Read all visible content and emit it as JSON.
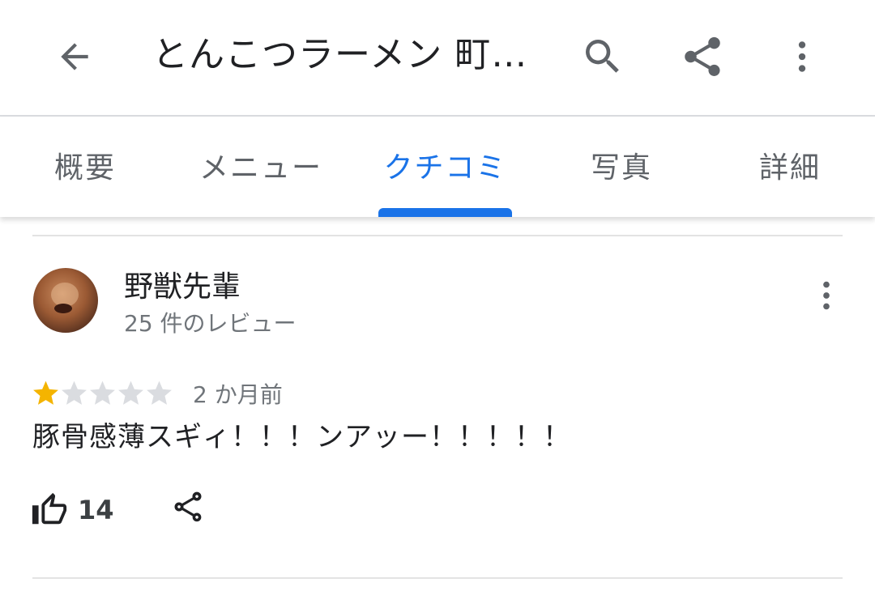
{
  "appbar": {
    "title": "とんこつラーメン 町…",
    "back_icon": "arrow-back-icon",
    "search_icon": "search-icon",
    "share_icon": "share-icon",
    "more_icon": "more-vert-icon"
  },
  "tabs": [
    {
      "label": "概要",
      "active": false
    },
    {
      "label": "メニュー",
      "active": false
    },
    {
      "label": "クチコミ",
      "active": true
    },
    {
      "label": "写真",
      "active": false
    },
    {
      "label": "詳細",
      "active": false
    }
  ],
  "review": {
    "author": "野獣先輩",
    "review_count": "25 件のレビュー",
    "rating": 1,
    "rating_max": 5,
    "time": "2 か月前",
    "text": "豚骨感薄スギィ！！！ンアッー！！！！！",
    "likes": "14"
  },
  "colors": {
    "accent": "#1a73e8",
    "star_filled": "#f4b400",
    "star_empty": "#dadce0",
    "icon": "#5f6368"
  }
}
